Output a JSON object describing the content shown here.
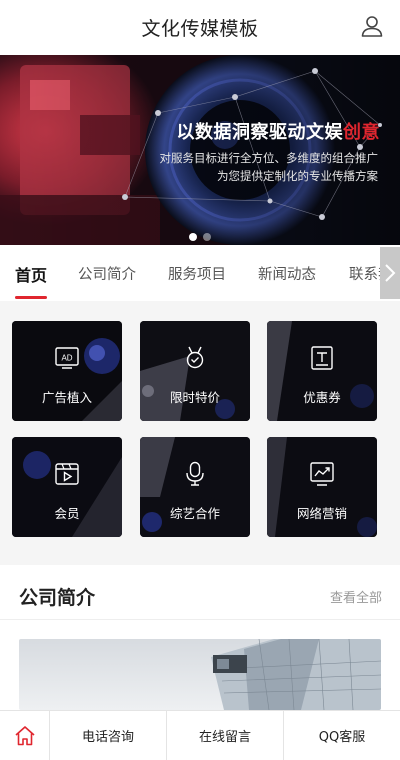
{
  "header": {
    "title": "文化传媒模板",
    "user_icon": "user-icon"
  },
  "banner": {
    "headline_main": "以数据洞察驱动文娱",
    "headline_highlight": "创意",
    "subline_1": "对服务目标进行全方位、多维度的组合推广",
    "subline_2": "为您提供定制化的专业传播方案",
    "active_slide": 1,
    "slide_count": 2,
    "accent_color": "#e0262f"
  },
  "tabs": {
    "items": [
      {
        "label": "首页",
        "active": true
      },
      {
        "label": "公司简介",
        "active": false
      },
      {
        "label": "服务项目",
        "active": false
      },
      {
        "label": "新闻动态",
        "active": false
      },
      {
        "label": "联系我们",
        "active": false
      }
    ],
    "scroll_icon": "chevron-right-icon"
  },
  "grid": {
    "items": [
      {
        "label": "广告植入",
        "icon": "ad-icon"
      },
      {
        "label": "限时特价",
        "icon": "medal-icon"
      },
      {
        "label": "优惠券",
        "icon": "coupon-icon"
      },
      {
        "label": "会员",
        "icon": "video-icon"
      },
      {
        "label": "综艺合作",
        "icon": "microphone-icon"
      },
      {
        "label": "网络营销",
        "icon": "chart-icon"
      }
    ]
  },
  "company_section": {
    "title": "公司简介",
    "more_label": "查看全部"
  },
  "bottom_bar": {
    "home_icon": "home-icon",
    "items": [
      {
        "label": "电话咨询"
      },
      {
        "label": "在线留言"
      },
      {
        "label": "QQ客服"
      }
    ]
  }
}
